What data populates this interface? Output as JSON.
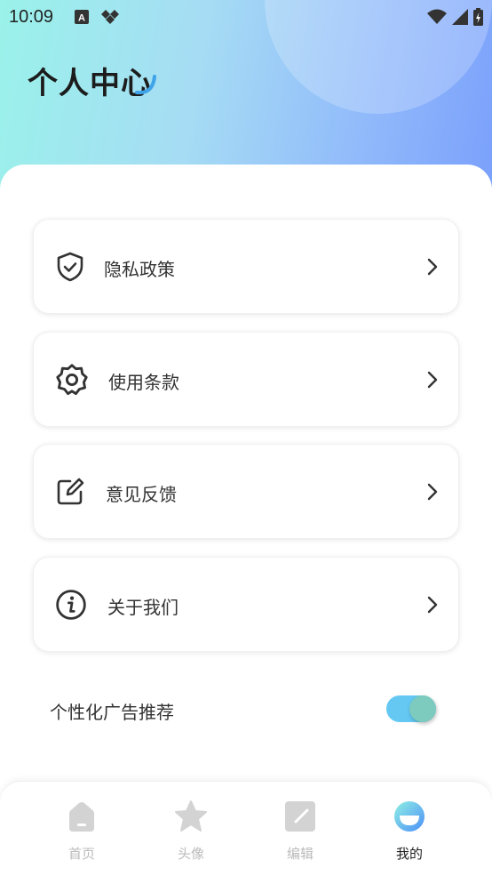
{
  "status_bar": {
    "time": "10:09",
    "left_icons": [
      "text-a-icon",
      "diamond-icon"
    ],
    "right_icons": [
      "wifi-icon",
      "signal-icon",
      "battery-icon"
    ]
  },
  "header": {
    "title": "个人中心"
  },
  "menu": {
    "items": [
      {
        "label": "隐私政策",
        "icon": "shield-check-icon"
      },
      {
        "label": "使用条款",
        "icon": "gear-icon"
      },
      {
        "label": "意见反馈",
        "icon": "edit-icon"
      },
      {
        "label": "关于我们",
        "icon": "info-icon"
      }
    ]
  },
  "settings": {
    "personalized_ads_label": "个性化广告推荐",
    "personalized_ads_enabled": true
  },
  "bottom_nav": {
    "items": [
      {
        "label": "首页",
        "icon": "home-icon",
        "active": false
      },
      {
        "label": "头像",
        "icon": "star-icon",
        "active": false
      },
      {
        "label": "编辑",
        "icon": "edit-square-icon",
        "active": false
      },
      {
        "label": "我的",
        "icon": "profile-smile-icon",
        "active": true
      }
    ]
  },
  "colors": {
    "toggle_track": "#64c8f3",
    "toggle_knob": "#7ccbbe",
    "nav_inactive": "#bbbbbb",
    "nav_active": "#222222"
  }
}
